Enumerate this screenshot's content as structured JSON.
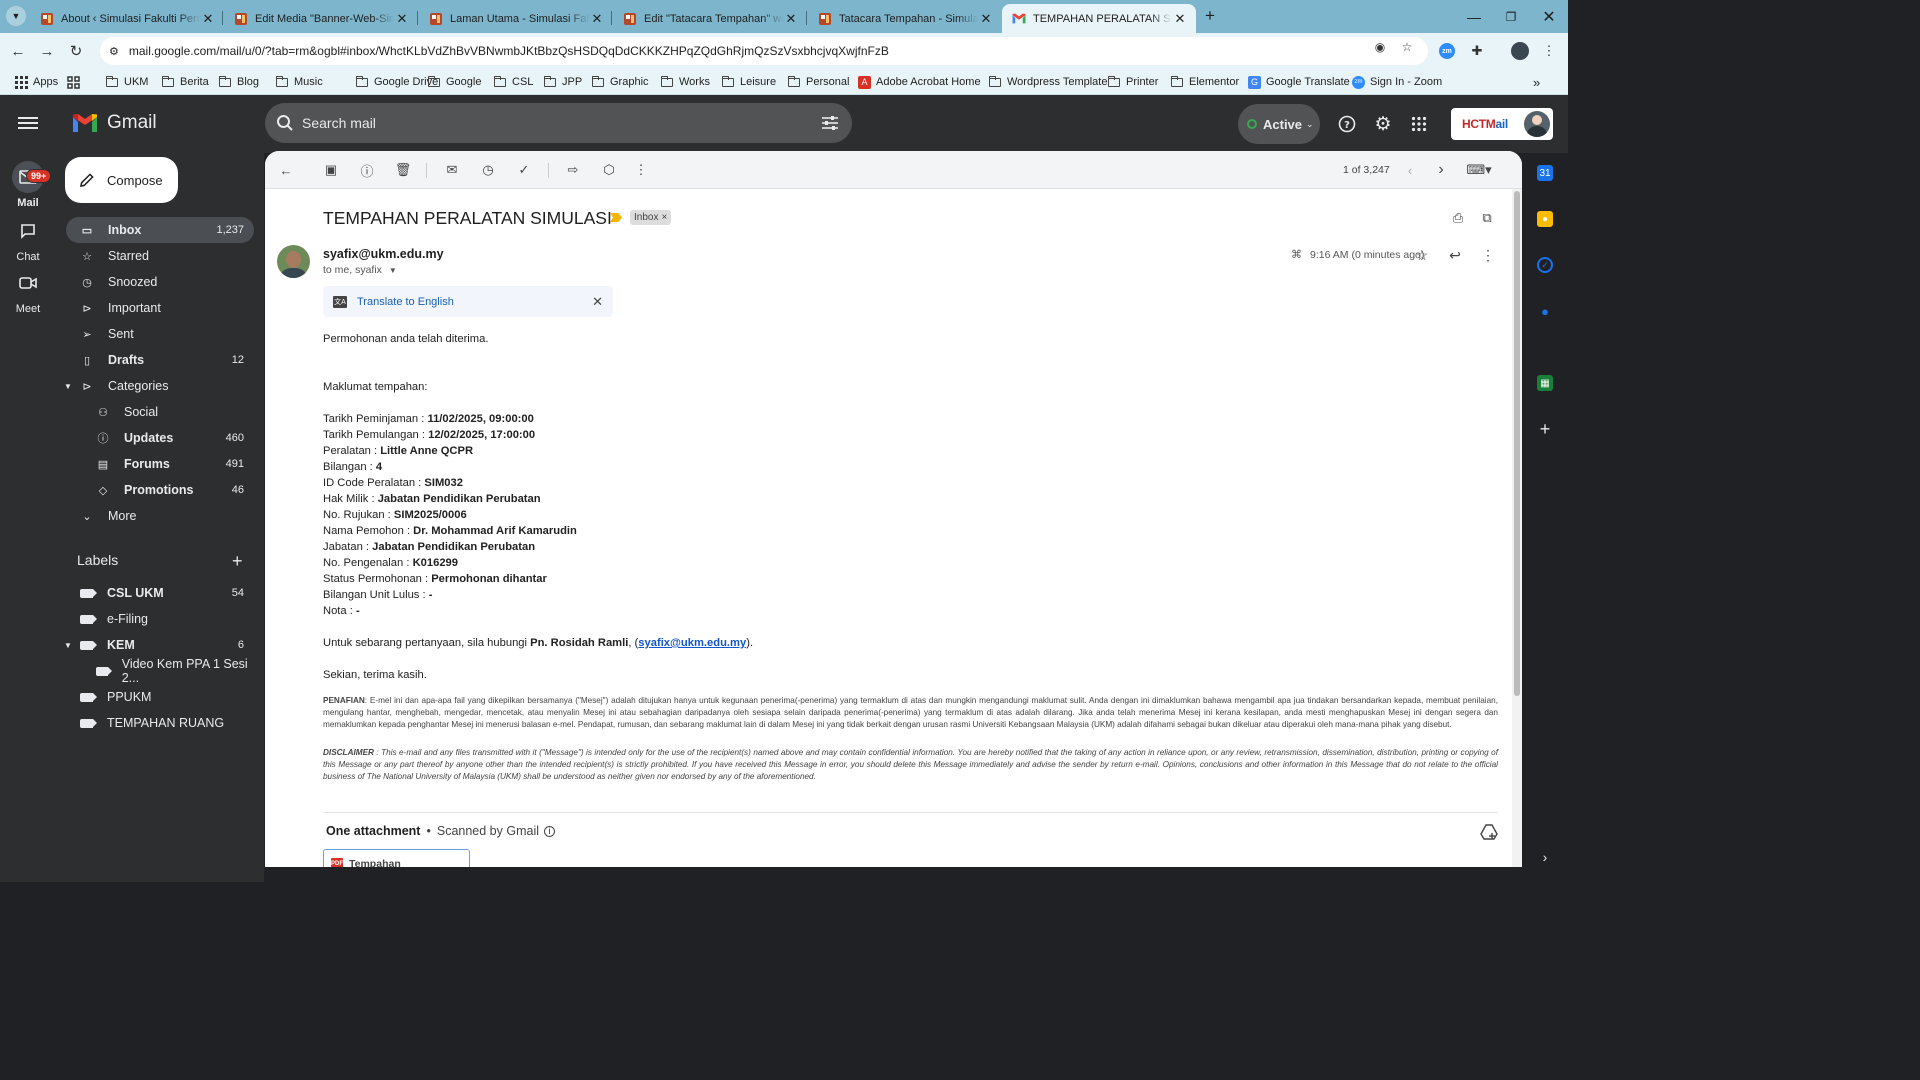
{
  "browser": {
    "tabs": [
      {
        "title": "About ‹ Simulasi Fakulti Perubatan — WordPress",
        "favicon": "wordpress-icon"
      },
      {
        "title": "Edit Media \"Banner-Web-Sim\" ‹ Simulasi",
        "favicon": "wordpress-icon"
      },
      {
        "title": "Laman Utama - Simulasi Fakulti Perubatan",
        "favicon": "wordpress-icon"
      },
      {
        "title": "Edit \"Tatacara Tempahan\" with Elementor",
        "favicon": "wordpress-icon"
      },
      {
        "title": "Tatacara Tempahan - Simulasi Fakulti Perubatan",
        "favicon": "wordpress-icon"
      },
      {
        "title": "TEMPAHAN PERALATAN SIMULASI - syafix@ukm.edu.my",
        "favicon": "gmail-icon",
        "active": true
      }
    ],
    "url": "mail.google.com/mail/u/0/?tab=rm&ogbl#inbox/WhctKLbVdZhBvVBNwmbJKtBbzQsHSDQqDdCKKKZHPqZQdGhRjmQzSzVsxbhcjvqXwjfnFzB",
    "bookmarks": [
      {
        "label": "Apps",
        "icon": "apps-grid-icon"
      },
      {
        "label": "",
        "icon": "grid-icon"
      },
      {
        "label": "UKM",
        "icon": "folder-icon"
      },
      {
        "label": "Berita",
        "icon": "folder-icon"
      },
      {
        "label": "Blog",
        "icon": "folder-icon"
      },
      {
        "label": "Music",
        "icon": "folder-icon"
      },
      {
        "label": "Google Drive",
        "icon": "folder-icon"
      },
      {
        "label": "Google",
        "icon": "folder-icon"
      },
      {
        "label": "CSL",
        "icon": "folder-icon"
      },
      {
        "label": "JPP",
        "icon": "folder-icon"
      },
      {
        "label": "Graphic",
        "icon": "folder-icon"
      },
      {
        "label": "Works",
        "icon": "folder-icon"
      },
      {
        "label": "Leisure",
        "icon": "folder-icon"
      },
      {
        "label": "Personal",
        "icon": "folder-icon"
      },
      {
        "label": "Adobe Acrobat Home",
        "icon": "acrobat-icon"
      },
      {
        "label": "Wordpress Template",
        "icon": "folder-icon"
      },
      {
        "label": "Printer",
        "icon": "folder-icon"
      },
      {
        "label": "Elementor",
        "icon": "folder-icon"
      },
      {
        "label": "Google Translate",
        "icon": "translate-icon"
      },
      {
        "label": "Sign In - Zoom",
        "icon": "zoom-icon"
      }
    ],
    "bookmarks_overflow": "»",
    "omnibox_icons": [
      "site-info-icon",
      "eye-icon",
      "star-icon"
    ]
  },
  "gmail": {
    "app_name": "Gmail",
    "search_placeholder": "Search mail",
    "status": "Active",
    "account_logo": {
      "a": "HCTM",
      "b": "ail"
    },
    "rail": [
      {
        "label": "Mail",
        "icon": "mail-icon",
        "badge": "99+",
        "active": true
      },
      {
        "label": "Chat",
        "icon": "chat-icon"
      },
      {
        "label": "Meet",
        "icon": "meet-icon"
      }
    ],
    "compose": "Compose",
    "nav": [
      {
        "label": "Inbox",
        "count": "1,237",
        "icon": "inbox-icon",
        "selected": true
      },
      {
        "label": "Starred",
        "count": "",
        "icon": "star-icon"
      },
      {
        "label": "Snoozed",
        "count": "",
        "icon": "clock-icon"
      },
      {
        "label": "Important",
        "count": "",
        "icon": "important-icon"
      },
      {
        "label": "Sent",
        "count": "",
        "icon": "send-icon"
      },
      {
        "label": "Drafts",
        "count": "12",
        "icon": "draft-icon",
        "bold": true
      },
      {
        "label": "Categories",
        "count": "",
        "icon": "label-icon",
        "caret": true
      },
      {
        "label": "Social",
        "count": "",
        "icon": "people-icon",
        "sub": true
      },
      {
        "label": "Updates",
        "count": "460",
        "icon": "info-icon",
        "sub": true,
        "bold": true
      },
      {
        "label": "Forums",
        "count": "491",
        "icon": "forum-icon",
        "sub": true,
        "bold": true
      },
      {
        "label": "Promotions",
        "count": "46",
        "icon": "tag-icon",
        "sub": true,
        "bold": true
      },
      {
        "label": "More",
        "count": "",
        "icon": "chevron-down-icon"
      }
    ],
    "labels_title": "Labels",
    "labels": [
      {
        "label": "CSL UKM",
        "count": "54",
        "bold": true
      },
      {
        "label": "e-Filing",
        "count": ""
      },
      {
        "label": "KEM",
        "count": "6",
        "bold": true,
        "caret": true
      },
      {
        "label": "Video Kem PPA 1 Sesi 2...",
        "count": "",
        "sub": true
      },
      {
        "label": "PPUKM",
        "count": ""
      },
      {
        "label": "TEMPAHAN RUANG",
        "count": ""
      }
    ]
  },
  "email": {
    "pager": "1 of 3,247",
    "subject": "TEMPAHAN PERALATAN SIMULASI",
    "label_chip": "Inbox",
    "label_chip_close": "×",
    "sender": "syafix@ukm.edu.my",
    "to": "to me, syafix",
    "time": "9:16 AM (0 minutes ago)",
    "translate": "Translate to English",
    "intro": "Permohonan anda telah diterima.",
    "details_title": "Maklumat tempahan:",
    "details": [
      {
        "k": "Tarikh Peminjaman : ",
        "v": "11/02/2025, 09:00:00"
      },
      {
        "k": "Tarikh Pemulangan : ",
        "v": "12/02/2025, 17:00:00"
      },
      {
        "k": "Peralatan : ",
        "v": "Little Anne QCPR"
      },
      {
        "k": "Bilangan : ",
        "v": "4"
      },
      {
        "k": "ID Code Peralatan : ",
        "v": "SIM032"
      },
      {
        "k": "Hak Milik : ",
        "v": "Jabatan Pendidikan Perubatan"
      },
      {
        "k": "No. Rujukan : ",
        "v": "SIM2025/0006"
      },
      {
        "k": "Nama Pemohon : ",
        "v": "Dr. Mohammad Arif Kamarudin"
      },
      {
        "k": "Jabatan : ",
        "v": "Jabatan Pendidikan Perubatan"
      },
      {
        "k": "No. Pengenalan : ",
        "v": "K016299"
      },
      {
        "k": "Status Permohonan : ",
        "v": "Permohonan dihantar"
      },
      {
        "k": "Bilangan Unit Lulus : ",
        "v": "-"
      },
      {
        "k": "Nota : ",
        "v": "-"
      }
    ],
    "contact_prefix": "Untuk sebarang pertanyaan, sila hubungi ",
    "contact_name": "Pn. Rosidah Ramli",
    "contact_mid": ", (",
    "contact_email": "syafix@ukm.edu.my",
    "contact_suffix": ").",
    "closing": "Sekian, terima kasih.",
    "penafian_label": "PENAFIAN",
    "penafian": ": E-mel ini dan apa-apa fail yang dikepilkan bersamanya (\"Mesej\") adalah ditujukan hanya untuk kegunaan penerima(-penerima) yang termaklum di atas dan mungkin mengandungi maklumat sulit. Anda dengan ini dimaklumkan bahawa mengambil apa jua tindakan bersandarkan kepada, membuat penilaian, mengulang hantar, menghebah, mengedar, mencetak, atau menyalin Mesej ini atau sebahagian daripadanya oleh sesiapa selain daripada penerima(-penerima) yang termaklum di atas adalah dilarang. Jika anda telah menerima Mesej ini kerana kesilapan, anda mesti menghapuskan Mesej ini dengan segera dan memaklumkan kepada penghantar Mesej ini menerusi balasan e-mel. Pendapat, rumusan, dan sebarang maklumat lain di dalam Mesej ini yang tidak berkait dengan urusan rasmi Universiti Kebangsaan Malaysia (UKM) adalah difahami sebagai bukan dikeluar atau diperakui oleh mana-mana pihak yang disebut.",
    "disclaimer_label": "DISCLAIMER",
    "disclaimer": " : This e-mail and any files transmitted with it (\"Message\") is intended only for the use of the recipient(s) named above and may contain confidential information. You are hereby notified that the taking of any action in reliance upon, or any review, retransmission, dissemination, distribution, printing or copying of this Message or any part thereof by anyone other than the intended recipient(s) is strictly prohibited. If you have received this Message in error, you should delete this Message immediately and advise the sender by return e-mail. Opinions, conclusions and other information in this Message that do not relate to the official business of The National University of Malaysia (UKM) shall be understood as neither given nor endorsed by any of the aforementioned.",
    "attachments_title": "One attachment",
    "attachments_sep": "•",
    "attachments_scanned": "Scanned by Gmail",
    "attachment_name": "Tempahan",
    "attachment_type": "PDF"
  }
}
